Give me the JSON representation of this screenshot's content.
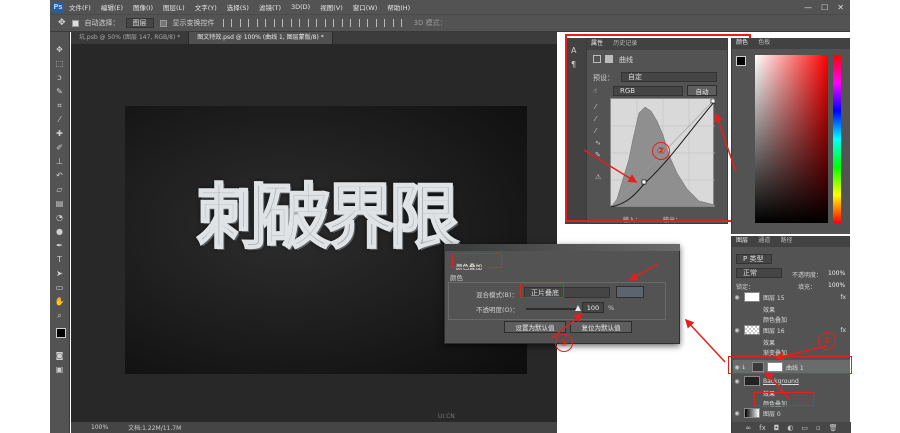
{
  "app": {
    "logo": "Ps"
  },
  "menubar": {
    "items": [
      "文件(F)",
      "编辑(E)",
      "图像(I)",
      "图层(L)",
      "文字(Y)",
      "选择(S)",
      "滤镜(T)",
      "3D(D)",
      "视图(V)",
      "窗口(W)",
      "帮助(H)"
    ],
    "window_controls": [
      "—",
      "☐",
      "✕"
    ]
  },
  "optionsbar": {
    "auto_select_label": "自动选择：",
    "auto_select_value": "图层",
    "show_transform_label": "显示变换控件",
    "mode_3d_label": "3D 模式："
  },
  "tabs": [
    {
      "label": "坑.psb @ 50% (图层 147, RGB/8) *",
      "active": false
    },
    {
      "label": "图文特效.psd @ 100% (曲线 1, 图层蒙版/8) *",
      "active": true
    }
  ],
  "artwork": {
    "title": "刺破界限"
  },
  "statusbar": {
    "zoom": "100%",
    "doc_info": "文档:1.22M/11.7M"
  },
  "properties": {
    "tabs": [
      "属性",
      "历史记录"
    ],
    "panel_name": "曲线",
    "preset_label": "预设：",
    "preset_value": "自定",
    "channel_value": "RGB",
    "auto_button": "自动",
    "input_label": "输入：",
    "output_label": "输出："
  },
  "color_panel": {
    "tabs": [
      "颜色",
      "色板"
    ]
  },
  "layers": {
    "tabs": [
      "图层",
      "通道",
      "路径"
    ],
    "filter_value": "P 类型",
    "blend_mode": "正常",
    "opacity_label": "不透明度：",
    "opacity_value": "100%",
    "lock_label": "锁定：",
    "fill_label": "填充：",
    "fill_value": "100%",
    "rows": [
      {
        "name": "图层 15",
        "kind": "layer"
      },
      {
        "name": "效果",
        "kind": "effect-group"
      },
      {
        "name": "颜色叠加",
        "kind": "effect"
      },
      {
        "name": "图层 16",
        "kind": "layer"
      },
      {
        "name": "效果",
        "kind": "effect-group"
      },
      {
        "name": "渐变叠加",
        "kind": "effect"
      },
      {
        "name": "曲线 1",
        "kind": "adjustment"
      },
      {
        "name": "Background",
        "kind": "layer"
      },
      {
        "name": "效果",
        "kind": "effect-group"
      },
      {
        "name": "颜色叠加",
        "kind": "effect"
      },
      {
        "name": "图层 0",
        "kind": "layer"
      }
    ]
  },
  "dialog": {
    "title": "颜色叠加",
    "section": "颜色",
    "blend_label": "混合模式(B)：",
    "blend_value": "正片叠底",
    "opacity_label": "不透明度(O)：",
    "opacity_value": "100",
    "opacity_unit": "%",
    "opacity_level": 1.0,
    "set_default": "设置为默认值",
    "reset_default": "复位为默认值"
  },
  "annotations": {
    "marker_1": "①",
    "marker_2": "②",
    "marker_3": "③"
  },
  "colors": {
    "annotation_red": "#e3201b",
    "overlay_swatch": "#5c6470",
    "panel": "#535353",
    "canvas": "#282828"
  },
  "watermark": "UI.CN"
}
